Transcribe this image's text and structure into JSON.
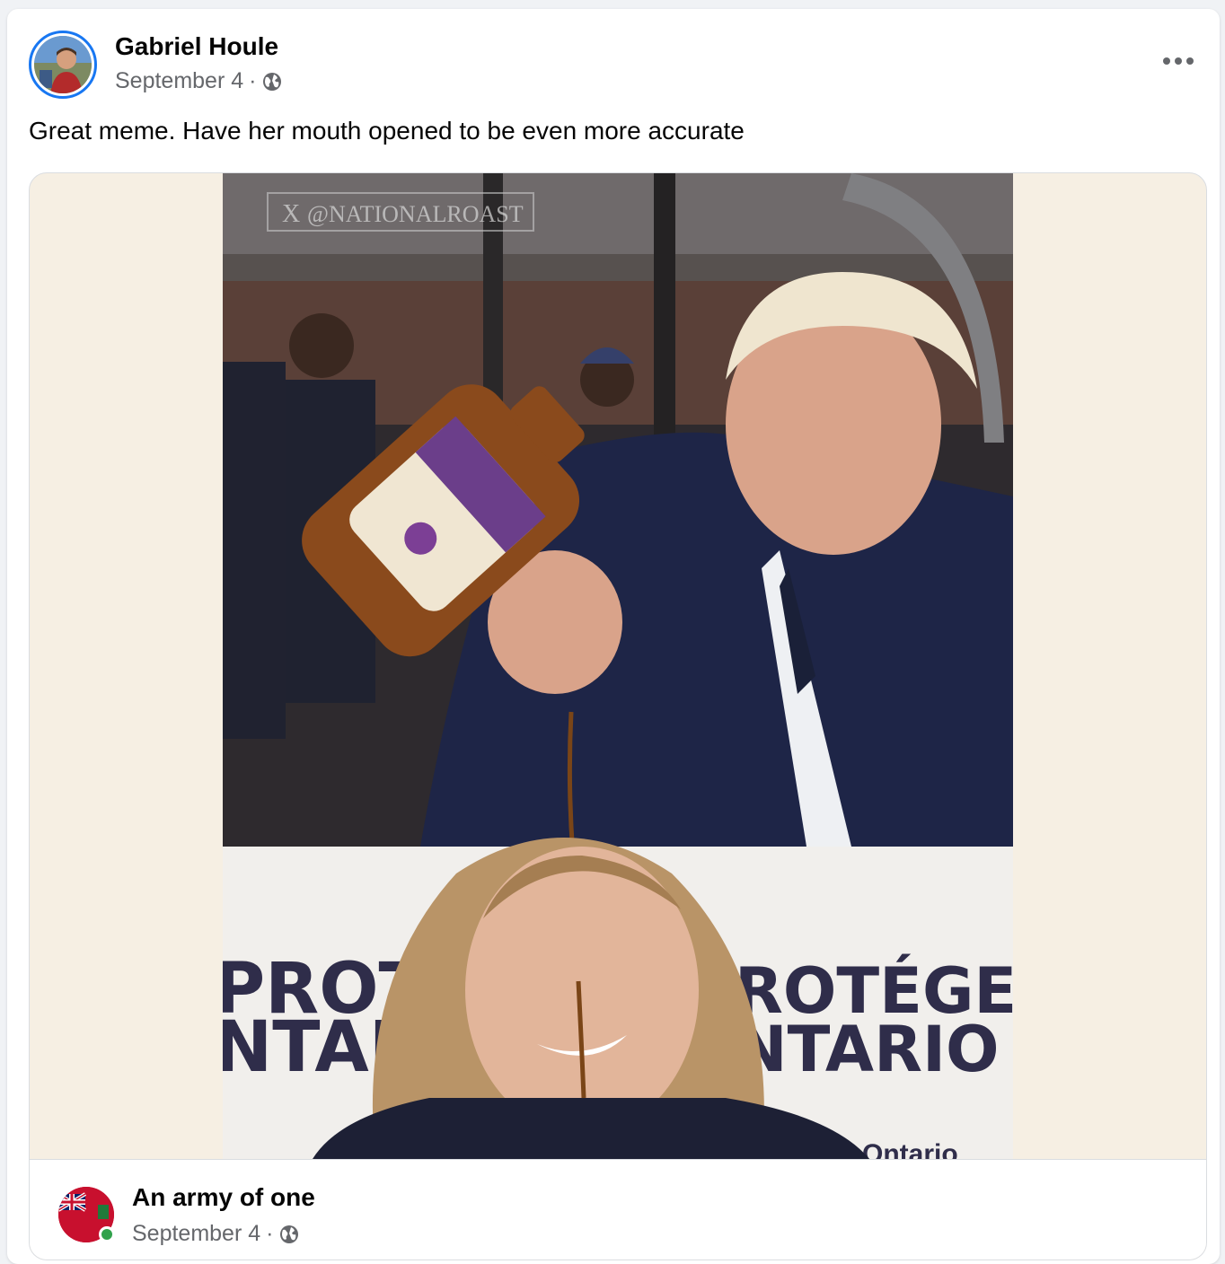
{
  "post": {
    "author": "Gabriel Houle",
    "date": "September 4",
    "separator": "·",
    "privacy_icon": "globe-icon",
    "more_icon": "more-options-icon",
    "text": "Great meme. Have her mouth opened to be even more accurate"
  },
  "image": {
    "watermark": "@NATIONALROAST",
    "sign_left_line1": "PROTE",
    "sign_left_line2": "NTAR",
    "sign_right_line1": "ROTÉGER",
    "sign_right_line2": "NTARIO",
    "sign_logo": "Ontario"
  },
  "shared": {
    "author": "An army of one",
    "date": "September 4",
    "separator": "·",
    "privacy_icon": "globe-icon",
    "status": "online"
  },
  "colors": {
    "accent": "#1877f2",
    "online": "#31a24c",
    "secondary_text": "#65676b",
    "attachment_bg": "#f6efe3"
  }
}
